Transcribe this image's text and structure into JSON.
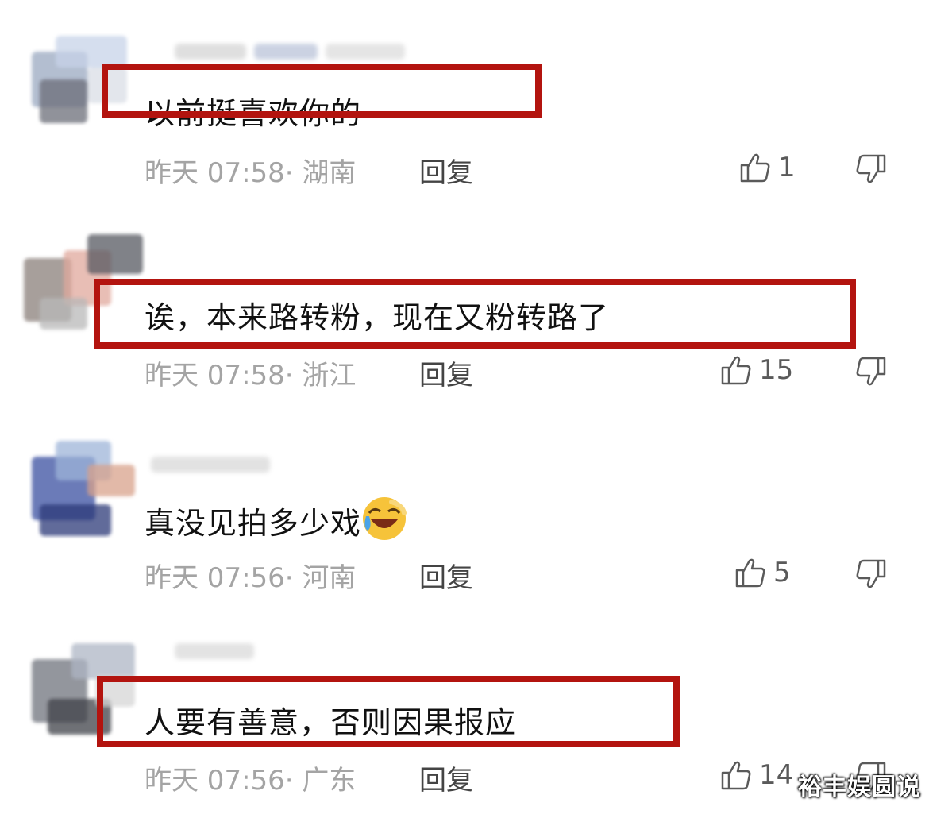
{
  "comments": [
    {
      "text": "以前挺喜欢你的",
      "time": "昨天 07:58",
      "location": "· 湖南",
      "likes": "1",
      "highlighted": true
    },
    {
      "text": "诶，本来路转粉，现在又粉转路了",
      "time": "昨天 07:58",
      "location": "· 浙江",
      "likes": "15",
      "highlighted": true
    },
    {
      "text": "真没见拍多少戏",
      "time": "昨天 07:56",
      "location": "· 河南",
      "likes": "5",
      "highlighted": false,
      "emoji": "laughing-crying-emoji"
    },
    {
      "text": "人要有善意，否则因果报应",
      "time": "昨天 07:56",
      "location": "· 广东",
      "likes": "14",
      "highlighted": true
    }
  ],
  "reply_label": "回复",
  "watermark": "裕丰娱圆说",
  "colors": {
    "highlight": "#b3140f",
    "meta": "#a4a4a4",
    "text": "#111111"
  },
  "icons": {
    "like": "thumbs-up-icon",
    "dislike": "thumbs-down-icon"
  }
}
